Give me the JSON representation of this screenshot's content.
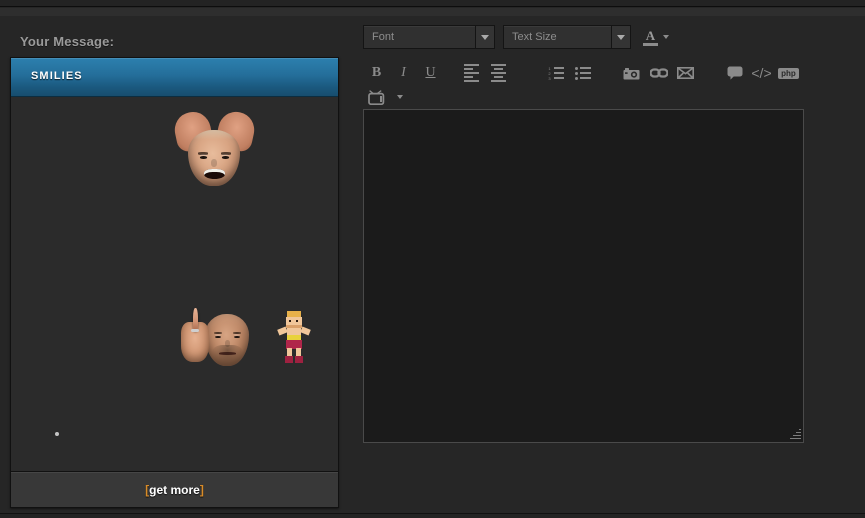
{
  "page": {
    "background_color": "#262626",
    "accent_color": "#2a7aa8",
    "link_color": "#d88b28"
  },
  "message_form": {
    "label": "Your Message:"
  },
  "smilies_panel": {
    "header_title": "SMILIES",
    "footer": {
      "open_bracket": "[",
      "label": "get more",
      "close_bracket": "]"
    },
    "columns": 4,
    "rows": [
      [
        {
          "name": "smiley-david-otunga-smirk",
          "title": "Otunga"
        },
        {
          "name": "smiley-cm-punk-confused",
          "title": "Punk Confused"
        },
        {
          "name": "smiley-ric-flair-crying",
          "title": "Flair Crying"
        },
        {
          "name": "smiley-triple-h-stare",
          "title": "Triple H"
        }
      ],
      [
        {
          "name": "smiley-shouting-face",
          "title": "Shouting"
        },
        {
          "name": "smiley-cm-punk-smug",
          "title": "Punk Smug"
        },
        {
          "name": "smiley-cornrows-laugh",
          "title": "Laughing"
        },
        {
          "name": "smiley-chris-jericho-grin",
          "title": "Jericho Grin"
        }
      ],
      [
        {
          "name": "smiley-obama-not-bad",
          "title": "Not Bad"
        },
        {
          "name": "smiley-vince-mcmahon-wide-eyes",
          "title": "Vince"
        },
        {
          "name": "smiley-steve-austin-middle-finger",
          "title": "Austin Finger"
        },
        {
          "name": "smiley-pixel-wrestler",
          "title": "Pixel Wrestler"
        }
      ],
      [
        {
          "name": "smiley-glasses-nerd",
          "title": "Nerd"
        },
        {
          "name": "smiley-cm-punk-serious",
          "title": "Punk Serious"
        },
        {
          "name": "smiley-jericho-ginger-smile",
          "title": "Ginger Smile"
        },
        {
          "name": "smiley-heavy-guy-side-eye",
          "title": "Side Eye"
        }
      ]
    ]
  },
  "editor_toolbar": {
    "font_select": {
      "value": "Font",
      "icon": "chevron-down-icon"
    },
    "size_select": {
      "value": "Text Size",
      "icon": "chevron-down-icon"
    },
    "font_color": {
      "glyph": "A",
      "icon": "font-color-icon",
      "dropdown_icon": "chevron-down-icon"
    },
    "buttons": [
      {
        "name": "bold-button",
        "icon": "bold-icon",
        "label": "B"
      },
      {
        "name": "italic-button",
        "icon": "italic-icon",
        "label": "I"
      },
      {
        "name": "underline-button",
        "icon": "underline-icon",
        "label": "U"
      },
      {
        "name": "align-left-button",
        "icon": "align-left-icon",
        "label": ""
      },
      {
        "name": "align-center-button",
        "icon": "align-center-icon",
        "label": ""
      },
      {
        "name": "ordered-list-button",
        "icon": "ordered-list-icon",
        "label": ""
      },
      {
        "name": "unordered-list-button",
        "icon": "unordered-list-icon",
        "label": ""
      },
      {
        "name": "insert-image-button",
        "icon": "camera-icon",
        "label": ""
      },
      {
        "name": "insert-link-button",
        "icon": "link-icon",
        "label": ""
      },
      {
        "name": "insert-email-button",
        "icon": "envelope-icon",
        "label": ""
      },
      {
        "name": "insert-quote-button",
        "icon": "speech-bubble-icon",
        "label": ""
      },
      {
        "name": "insert-code-button",
        "icon": "code-tag-icon",
        "label": "</>"
      },
      {
        "name": "insert-php-button",
        "icon": "php-icon",
        "label": "php"
      },
      {
        "name": "insert-video-button",
        "icon": "tv-icon",
        "label": ""
      },
      {
        "name": "more-options-button",
        "icon": "chevron-down-icon",
        "label": ""
      },
      {
        "name": "align-right-button",
        "icon": "align-right-icon",
        "label": ""
      },
      {
        "name": "align-justify-button",
        "icon": "align-justify-icon",
        "label": ""
      }
    ]
  },
  "message_body": {
    "value": "",
    "placeholder": "",
    "resize_handle": "resize-grip-icon"
  }
}
